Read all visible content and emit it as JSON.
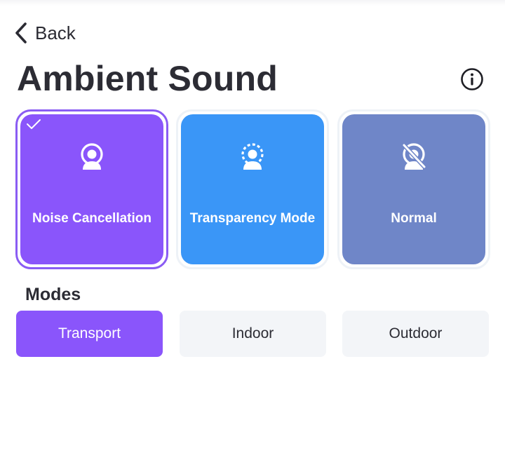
{
  "nav": {
    "back_label": "Back"
  },
  "header": {
    "title": "Ambient Sound",
    "info_icon": "info-circle-icon"
  },
  "ambient_modes": [
    {
      "label": "Noise Cancellation",
      "icon": "noise-cancellation-icon",
      "color": "#8a55fb",
      "selected": true
    },
    {
      "label": "Transparency Mode",
      "icon": "transparency-icon",
      "color": "#3a96f7",
      "selected": false
    },
    {
      "label": "Normal",
      "icon": "normal-mode-icon",
      "color": "#6f86c8",
      "selected": false
    }
  ],
  "modes_section": {
    "title": "Modes",
    "options": [
      {
        "label": "Transport",
        "active": true
      },
      {
        "label": "Indoor",
        "active": false
      },
      {
        "label": "Outdoor",
        "active": false
      }
    ],
    "active_color": "#8a55fb"
  }
}
